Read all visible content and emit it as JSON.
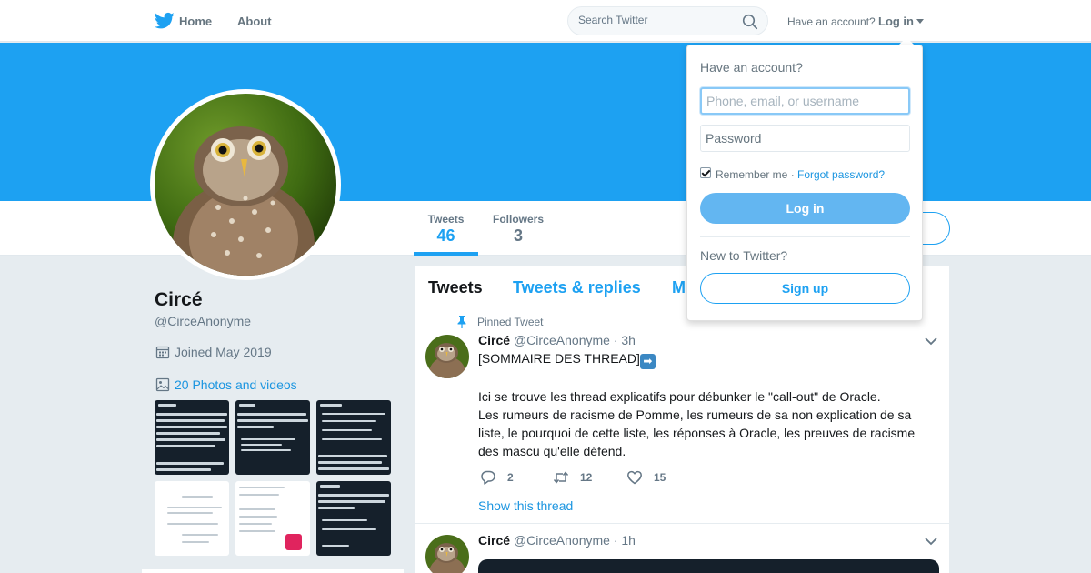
{
  "nav": {
    "logo_icon": "twitter-bird-icon",
    "home_label": "Home",
    "about_label": "About",
    "search_placeholder": "Search Twitter",
    "search_icon": "search-icon",
    "have_account": "Have an account?",
    "login_label": "Log in"
  },
  "colors": {
    "brand": "#1da1f2",
    "text": "#14171a",
    "muted": "#657786",
    "page_bg": "#e6ecf0",
    "banner": "#1da1f2"
  },
  "profile": {
    "name": "Circé",
    "handle": "@CirceAnonyme",
    "joined": "Joined May 2019",
    "photos_link": "20 Photos and videos",
    "stats": [
      {
        "label": "Tweets",
        "value": "46",
        "active": true
      },
      {
        "label": "Followers",
        "value": "3",
        "active": false
      }
    ]
  },
  "timeline": {
    "tabs": [
      "Tweets",
      "Tweets & replies",
      "M"
    ],
    "pinned_label": "Pinned Tweet",
    "tweets": [
      {
        "name": "Circé",
        "handle": "@CirceAnonyme",
        "time": "· 3h",
        "line1": "[SOMMAIRE DES THREAD]",
        "line1_emoji": "➡",
        "para": "Ici se trouve les thread explicatifs pour débunker le \"call-out\" de Oracle.",
        "para2": "Les rumeurs de racisme de Pomme, les rumeurs de sa non explication de sa liste, le pourquoi de cette liste, les réponses à Oracle, les preuves de racisme des mascu qu'elle défend.",
        "replies": "2",
        "retweets": "12",
        "likes": "15",
        "show_thread": "Show this thread"
      },
      {
        "name": "Circé",
        "handle": "@CirceAnonyme",
        "time": "· 1h"
      }
    ]
  },
  "login_dropdown": {
    "title": "Have an account?",
    "username_placeholder": "Phone, email, or username",
    "password_placeholder": "Password",
    "remember_label": "Remember me ·",
    "remember_checked": true,
    "forgot_label": "Forgot password?",
    "login_button": "Log in",
    "new_label": "New to Twitter?",
    "signup_button": "Sign up"
  }
}
